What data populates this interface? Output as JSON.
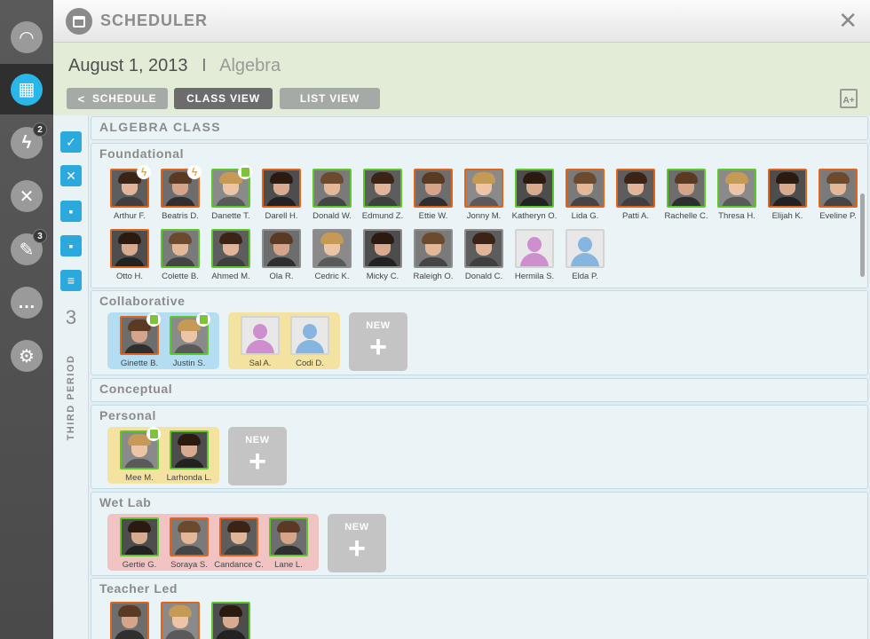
{
  "nav": {
    "items": [
      {
        "name": "dashboard-gauge-icon",
        "glyph": "◠",
        "badge": ""
      },
      {
        "name": "calendar-icon",
        "glyph": "▦",
        "badge": "",
        "active": true
      },
      {
        "name": "lightning-icon",
        "glyph": "ϟ",
        "badge": "2"
      },
      {
        "name": "tools-icon",
        "glyph": "✕",
        "badge": ""
      },
      {
        "name": "assignment-icon",
        "glyph": "✎",
        "badge": "3"
      },
      {
        "name": "chat-icon",
        "glyph": "…",
        "badge": ""
      },
      {
        "name": "settings-gear-icon",
        "glyph": "⚙",
        "badge": ""
      }
    ]
  },
  "header": {
    "title": "SCHEDULER",
    "close": "✕"
  },
  "subheader": {
    "date": "August 1, 2013",
    "separator": "I",
    "subject": "Algebra"
  },
  "tabs": {
    "schedule": "SCHEDULE",
    "class_view": "CLASS VIEW",
    "list_view": "LIST VIEW",
    "schedule_chevron": "<"
  },
  "grade_icon": "A+",
  "tools": {
    "period_number": "3",
    "period_label": "THIRD PERIOD"
  },
  "class_title": "ALGEBRA CLASS",
  "new_label": "NEW",
  "new_plus": "+",
  "sections": {
    "foundational": {
      "title": "Foundational",
      "row1": [
        {
          "name": "Arthur F.",
          "border": "orange",
          "badge": "bolt"
        },
        {
          "name": "Beatris D.",
          "border": "orange",
          "badge": "bolt"
        },
        {
          "name": "Danette T.",
          "border": "green",
          "badge": "clip"
        },
        {
          "name": "Darell H.",
          "border": "orange"
        },
        {
          "name": "Donald W.",
          "border": "green"
        },
        {
          "name": "Edmund Z.",
          "border": "green"
        },
        {
          "name": "Ettie W.",
          "border": "orange"
        },
        {
          "name": "Jonny M.",
          "border": "orange"
        },
        {
          "name": "Katheryn O.",
          "border": "green"
        },
        {
          "name": "Lida G.",
          "border": "orange"
        },
        {
          "name": "Patti A.",
          "border": "orange"
        },
        {
          "name": "Rachelle C.",
          "border": "green"
        },
        {
          "name": "Thresa H.",
          "border": "green"
        },
        {
          "name": "Elijah K.",
          "border": "orange"
        },
        {
          "name": "Eveline P.",
          "border": "orange"
        }
      ],
      "row2": [
        {
          "name": "Otto H.",
          "border": "orange"
        },
        {
          "name": "Colette B.",
          "border": "green"
        },
        {
          "name": "Ahmed M.",
          "border": "green"
        },
        {
          "name": "Ola R.",
          "border": "gray"
        },
        {
          "name": "Cedric K.",
          "border": "gray"
        },
        {
          "name": "Micky C.",
          "border": "gray"
        },
        {
          "name": "Raleigh O.",
          "border": "gray"
        },
        {
          "name": "Donald C.",
          "border": "gray"
        },
        {
          "name": "Hermila S.",
          "border": "none",
          "silhouette": "female"
        },
        {
          "name": "Elda P.",
          "border": "none",
          "silhouette": "male"
        }
      ]
    },
    "collaborative": {
      "title": "Collaborative",
      "group1": [
        {
          "name": "Ginette B.",
          "border": "orange",
          "badge": "clip"
        },
        {
          "name": "Justin S.",
          "border": "green",
          "badge": "clip"
        }
      ],
      "group2": [
        {
          "name": "Sal A.",
          "border": "none",
          "silhouette": "female"
        },
        {
          "name": "Codi D.",
          "border": "none",
          "silhouette": "male"
        }
      ]
    },
    "conceptual": {
      "title": "Conceptual"
    },
    "personal": {
      "title": "Personal",
      "group1": [
        {
          "name": "Mee M.",
          "border": "green",
          "badge": "clip"
        },
        {
          "name": "Larhonda L.",
          "border": "green"
        }
      ]
    },
    "wet_lab": {
      "title": "Wet Lab",
      "group1": [
        {
          "name": "Gertie G.",
          "border": "green"
        },
        {
          "name": "Soraya S.",
          "border": "orange"
        },
        {
          "name": "Candance C.",
          "border": "orange"
        },
        {
          "name": "Lane L.",
          "border": "green"
        }
      ]
    },
    "teacher_led": {
      "title": "Teacher Led",
      "row1": [
        {
          "name": "",
          "border": "orange"
        },
        {
          "name": "",
          "border": "orange"
        },
        {
          "name": "",
          "border": "green"
        }
      ]
    }
  },
  "colors": {
    "accent": "#29b6e8",
    "orange_border": "#e0641c",
    "green_border": "#5cc82c",
    "bolt": "#f0a318",
    "clip": "#7ec43b"
  }
}
